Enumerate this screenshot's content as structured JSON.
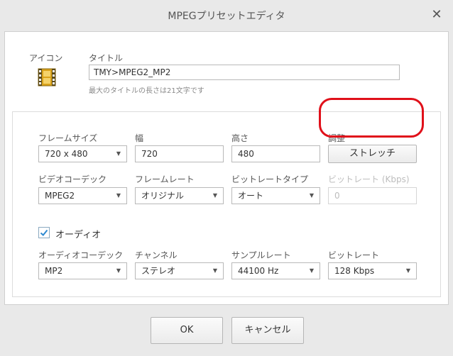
{
  "window": {
    "title": "MPEGプリセットエディタ"
  },
  "header": {
    "icon_label": "アイコン",
    "title_label": "タイトル",
    "title_value": "TMY>MPEG2_MP2",
    "title_hint": "最大のタイトルの長さは21文字です"
  },
  "video": {
    "frame_size_label": "フレームサイズ",
    "frame_size_value": "720 x 480",
    "width_label": "幅",
    "width_value": "720",
    "height_label": "高さ",
    "height_value": "480",
    "adjust_label": "調整",
    "adjust_button": "ストレッチ",
    "codec_label": "ビデオコーデック",
    "codec_value": "MPEG2",
    "framerate_label": "フレームレート",
    "framerate_value": "オリジナル",
    "bitrate_type_label": "ビットレートタイプ",
    "bitrate_type_value": "オート",
    "bitrate_label": "ビットレート (Kbps)",
    "bitrate_value": "0"
  },
  "audio": {
    "enabled_label": "オーディオ",
    "enabled": true,
    "codec_label": "オーディオコーデック",
    "codec_value": "MP2",
    "channel_label": "チャンネル",
    "channel_value": "ステレオ",
    "sample_rate_label": "サンプルレート",
    "sample_rate_value": "44100 Hz",
    "bitrate_label": "ビットレート",
    "bitrate_value": "128 Kbps"
  },
  "footer": {
    "ok_label": "OK",
    "cancel_label": "キャンセル"
  },
  "colors": {
    "highlight": "#e0101a",
    "check": "#2f8ad1",
    "film": "#d9a21b"
  }
}
